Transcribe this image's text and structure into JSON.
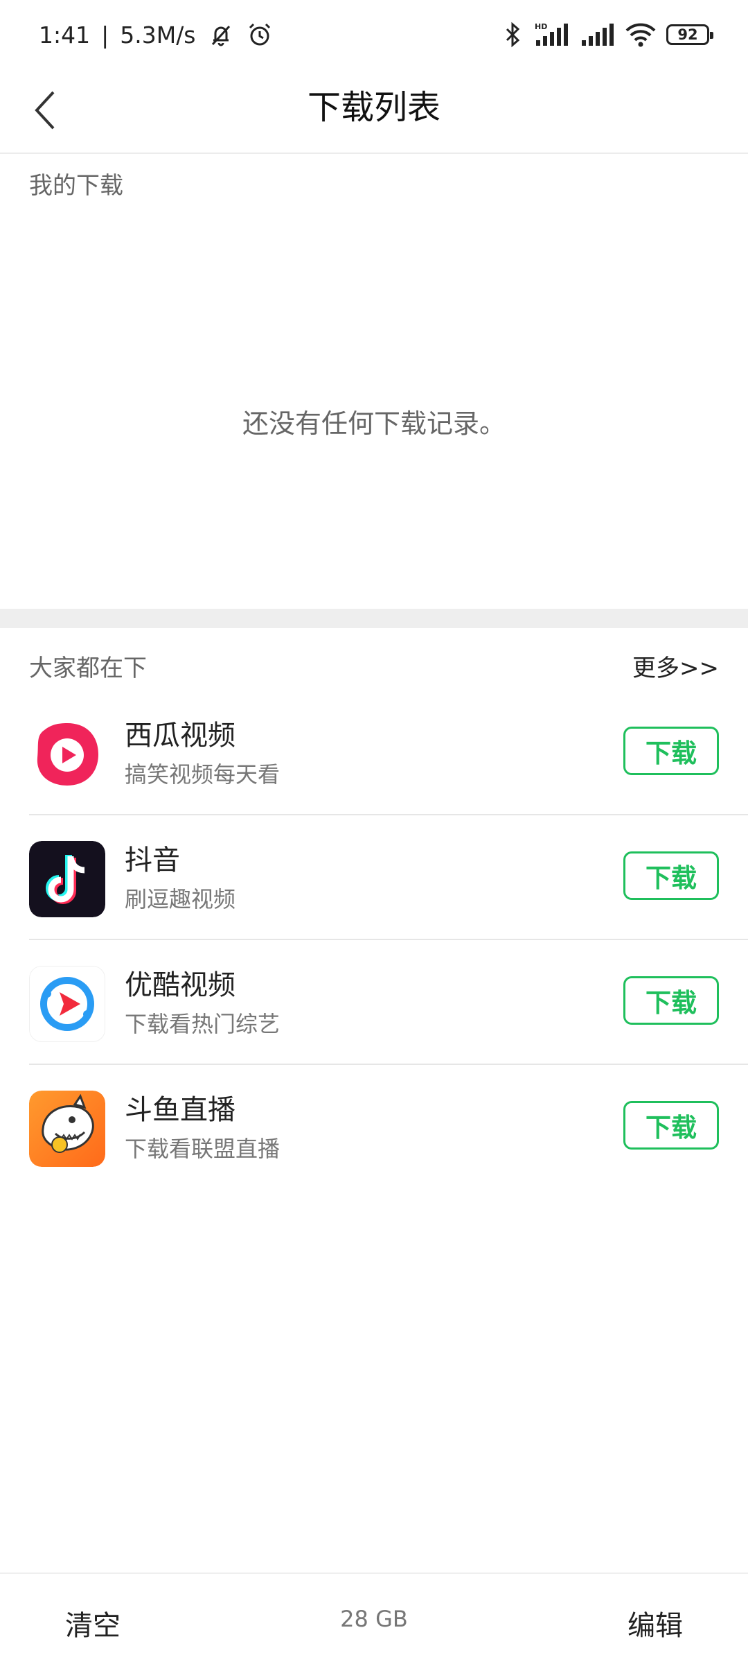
{
  "status_bar": {
    "time": "1:41",
    "speed": "5.3M/s",
    "separator": "|",
    "hd_label": "HD",
    "battery": "92"
  },
  "header": {
    "title": "下载列表"
  },
  "my_downloads": {
    "label": "我的下载",
    "empty_message": "还没有任何下载记录。"
  },
  "recommend": {
    "label": "大家都在下",
    "more_label": "更多>>",
    "apps": [
      {
        "name": "西瓜视频",
        "desc": "搞笑视频每天看",
        "button": "下载",
        "icon": "xigua-video-icon"
      },
      {
        "name": "抖音",
        "desc": "刷逗趣视频",
        "button": "下载",
        "icon": "douyin-icon"
      },
      {
        "name": "优酷视频",
        "desc": "下载看热门综艺",
        "button": "下载",
        "icon": "youku-icon"
      },
      {
        "name": "斗鱼直播",
        "desc": "下载看联盟直播",
        "button": "下载",
        "icon": "douyu-icon"
      }
    ]
  },
  "footer": {
    "clear_label": "清空",
    "storage": "28 GB",
    "edit_label": "编辑"
  },
  "colors": {
    "accent": "#1fbf5c",
    "divider": "#eeeeee"
  }
}
